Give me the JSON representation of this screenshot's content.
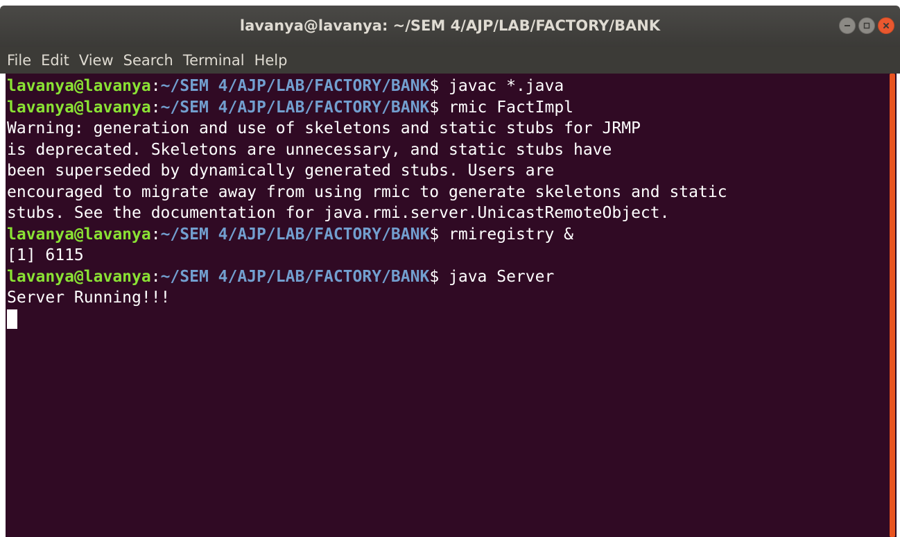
{
  "window": {
    "title": "lavanya@lavanya: ~/SEM 4/AJP/LAB/FACTORY/BANK",
    "buttons": [
      "minimize-icon",
      "maximize-icon",
      "close-icon"
    ]
  },
  "menu": {
    "items": [
      "File",
      "Edit",
      "View",
      "Search",
      "Terminal",
      "Help"
    ]
  },
  "terminal": {
    "colors": {
      "background": "#300a24",
      "user": "#8ae234",
      "path": "#729fcf",
      "text": "#ffffff",
      "scrollbar": "#e95420"
    },
    "prompt": {
      "user": "lavanya@lavanya",
      "separator": ":",
      "path": "~/SEM 4/AJP/LAB/FACTORY/BANK",
      "symbol": "$"
    },
    "lines": [
      {
        "type": "prompt",
        "command": " javac *.java"
      },
      {
        "type": "prompt",
        "command": " rmic FactImpl"
      },
      {
        "type": "output",
        "text": "Warning: generation and use of skeletons and static stubs for JRMP"
      },
      {
        "type": "output",
        "text": "is deprecated. Skeletons are unnecessary, and static stubs have"
      },
      {
        "type": "output",
        "text": "been superseded by dynamically generated stubs. Users are"
      },
      {
        "type": "output",
        "text": "encouraged to migrate away from using rmic to generate skeletons and static"
      },
      {
        "type": "output",
        "text": "stubs. See the documentation for java.rmi.server.UnicastRemoteObject."
      },
      {
        "type": "prompt",
        "command": " rmiregistry &"
      },
      {
        "type": "output",
        "text": "[1] 6115"
      },
      {
        "type": "prompt",
        "command": " java Server"
      },
      {
        "type": "output",
        "text": "Server Running!!!"
      }
    ]
  }
}
